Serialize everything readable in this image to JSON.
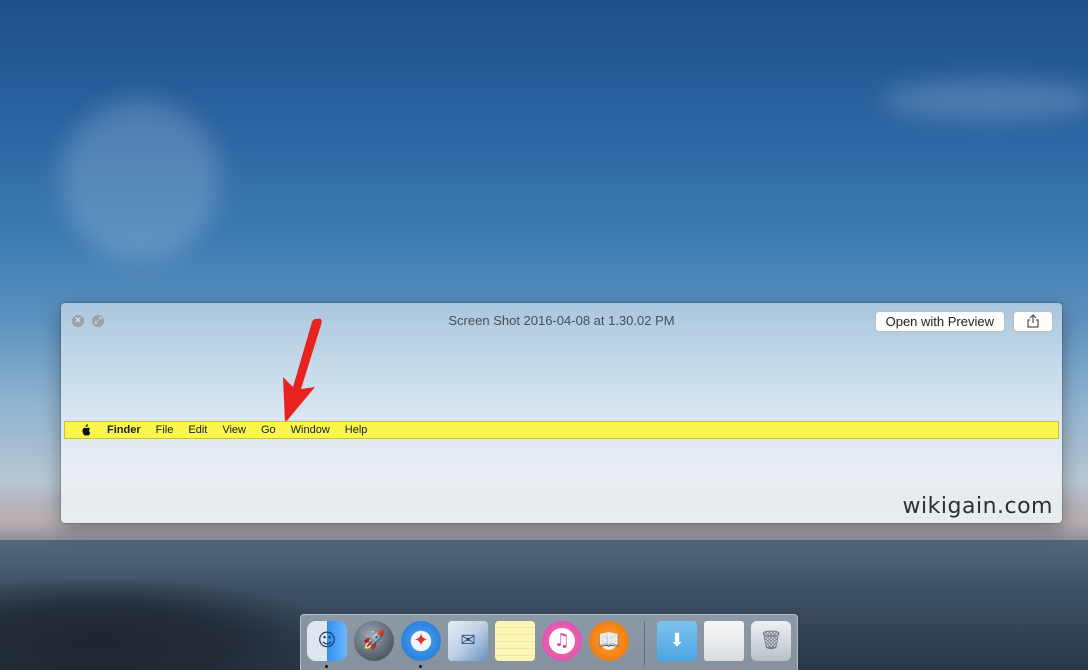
{
  "quicklook": {
    "title": "Screen Shot 2016-04-08 at 1.30.02 PM",
    "open_button_label": "Open with Preview",
    "close_symbol": "✕",
    "expand_symbol": "⤢",
    "share_icon": "share-icon"
  },
  "captured_menubar": {
    "background": "#faf64c",
    "apple_icon": "apple-icon",
    "items": [
      {
        "label": "Finder",
        "bold": true
      },
      {
        "label": "File"
      },
      {
        "label": "Edit"
      },
      {
        "label": "View"
      },
      {
        "label": "Go"
      },
      {
        "label": "Window"
      },
      {
        "label": "Help"
      }
    ]
  },
  "annotation": {
    "arrow_color": "#e8231f",
    "arrow_icon": "red-arrow-icon"
  },
  "watermark": "wikigain.com",
  "dock": {
    "apps": [
      {
        "name": "finder-icon"
      },
      {
        "name": "launchpad-icon"
      },
      {
        "name": "safari-icon"
      },
      {
        "name": "mail-icon"
      },
      {
        "name": "notes-icon"
      },
      {
        "name": "itunes-icon"
      },
      {
        "name": "ibooks-icon"
      },
      {
        "name": "downloads-folder-icon"
      },
      {
        "name": "documents-stack-icon"
      },
      {
        "name": "trash-icon"
      }
    ],
    "glyphs": {
      "finder": "☺",
      "launchpad": "🚀",
      "safari": "✦",
      "mail": "✉",
      "itunes": "♫",
      "ibooks": "📖",
      "downloads": "⬇",
      "trash": "🗑"
    }
  }
}
